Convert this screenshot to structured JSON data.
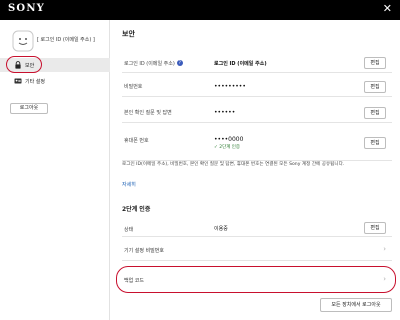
{
  "header": {
    "brand": "SONY",
    "close_symbol": "✕"
  },
  "sidebar": {
    "user_id": "[ 로그인 ID (이메일 주소) ]",
    "items": [
      {
        "label": "보안",
        "icon": "lock-icon",
        "active": true
      },
      {
        "label": "기타 설정",
        "icon": "id-card-icon",
        "active": false
      }
    ],
    "logout_label": "로그아웃"
  },
  "main": {
    "title": "보안",
    "rows": {
      "login": {
        "label": "로그인 ID (이메일 주소)",
        "help_symbol": "?",
        "value": "로그인 ID (이메일 주소)",
        "edit": "편집"
      },
      "password": {
        "label": "비밀번호",
        "value": "•••••••••",
        "edit": "편집"
      },
      "security_question": {
        "label": "본인 확인 질문 및 답변",
        "value": "••••••",
        "edit": "편집"
      },
      "phone": {
        "label": "휴대폰 번호",
        "value": "••••0000",
        "status": "✓ 2단계 인증",
        "edit": "편집"
      }
    },
    "note": "로그인 ID(이메일 주소), 비밀번호, 본인 확인 질문 및 답변, 휴대폰 번호는 연결된 모든 Sony 계정 간에 공유됩니다.",
    "more_link": "자세히",
    "two_step": {
      "title": "2단계 인증",
      "status_label": "상태",
      "status_value": "이용중",
      "edit": "편집",
      "device_password_label": "기기 설정 비밀번호",
      "backup_code_label": "백업 코드",
      "chevron": "›"
    },
    "signout_all_label": "모든 장치에서 로그아웃"
  },
  "colors": {
    "topbar": "#000000",
    "highlight": "#c8102e",
    "link": "#1a5fb4",
    "verified": "#2e7d32"
  }
}
